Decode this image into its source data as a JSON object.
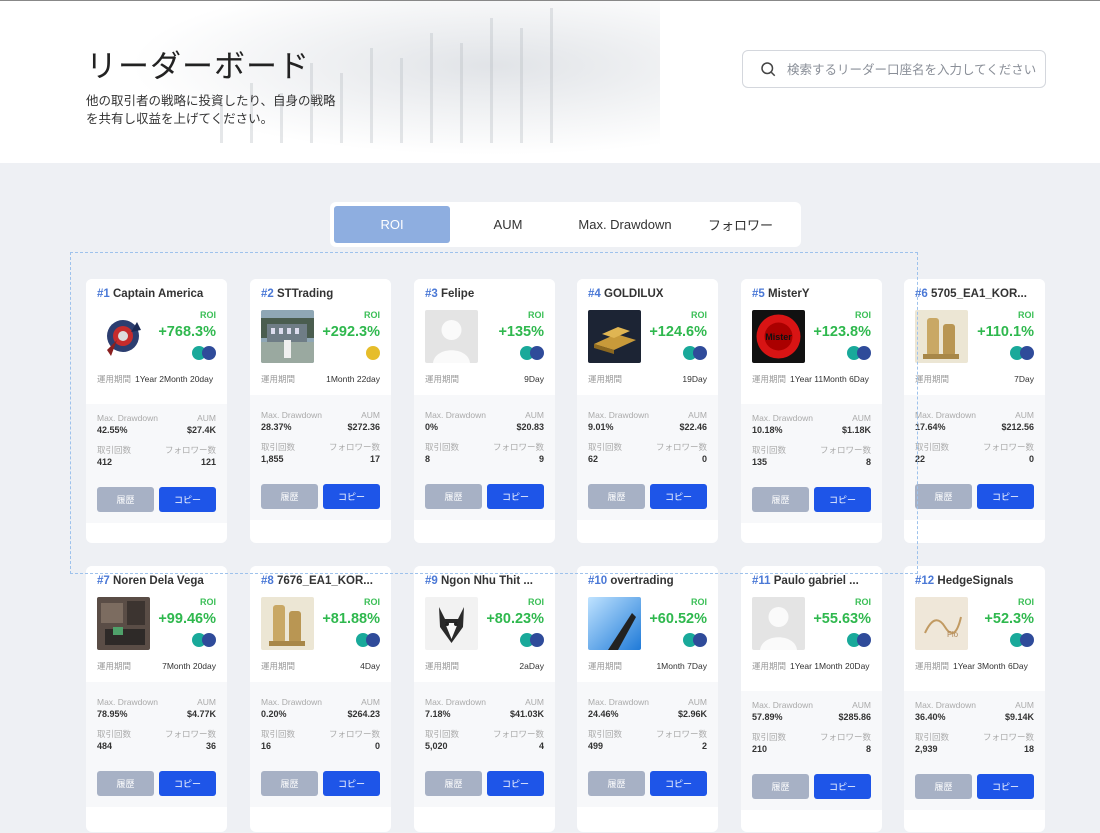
{
  "header": {
    "title": "リーダーボード",
    "subtitle": "他の取引者の戦略に投資したり、自身の戦略を共有し収益を上げてください。"
  },
  "search": {
    "placeholder": "検索するリーダー口座名を入力してください"
  },
  "tabs": [
    {
      "label": "ROI",
      "active": true
    },
    {
      "label": "AUM",
      "active": false
    },
    {
      "label": "Max. Drawdown",
      "active": false
    },
    {
      "label": "フォロワー",
      "active": false
    }
  ],
  "labels": {
    "roi": "ROI",
    "period": "運用期間",
    "max_drawdown": "Max. Drawdown",
    "aum": "AUM",
    "trades": "取引回数",
    "followers": "フォロワー数",
    "history": "履歴",
    "copy": "コピー"
  },
  "colors": {
    "accent": "#1e55e8",
    "tab_active": "#8eaee0",
    "roi_green": "#2fb84e",
    "rank_blue": "#4a78d6"
  },
  "cards": [
    {
      "rank": "#1",
      "name": "Captain America",
      "roi": "+768.3%",
      "period": "1Year 2Month 20day",
      "max_drawdown": "42.55%",
      "aum": "$27.4K",
      "trades": "412",
      "followers": "121",
      "avatar": "captain-america-art"
    },
    {
      "rank": "#2",
      "name": "STTrading",
      "roi": "+292.3%",
      "period": "1Month 22day",
      "max_drawdown": "28.37%",
      "aum": "$272.36",
      "trades": "1,855",
      "followers": "17",
      "avatar": "building-photo"
    },
    {
      "rank": "#3",
      "name": "Felipe",
      "roi": "+135%",
      "period": "9Day",
      "max_drawdown": "0%",
      "aum": "$20.83",
      "trades": "8",
      "followers": "9",
      "avatar": "default-user"
    },
    {
      "rank": "#4",
      "name": "GOLDILUX",
      "roi": "+124.6%",
      "period": "19Day",
      "max_drawdown": "9.01%",
      "aum": "$22.46",
      "trades": "62",
      "followers": "0",
      "avatar": "gold-bars"
    },
    {
      "rank": "#5",
      "name": "MisterY",
      "roi": "+123.8%",
      "period": "1Year 11Month 6Day",
      "max_drawdown": "10.18%",
      "aum": "$1.18K",
      "trades": "135",
      "followers": "8",
      "avatar": "red-logo"
    },
    {
      "rank": "#6",
      "name": "5705_EA1_KOR...",
      "roi": "+110.1%",
      "period": "7Day",
      "max_drawdown": "17.64%",
      "aum": "$212.56",
      "trades": "22",
      "followers": "0",
      "avatar": "gold-figure"
    },
    {
      "rank": "#7",
      "name": "Noren Dela Vega",
      "roi": "+99.46%",
      "period": "7Month 20day",
      "max_drawdown": "78.95%",
      "aum": "$4.77K",
      "trades": "484",
      "followers": "36",
      "avatar": "room-photo"
    },
    {
      "rank": "#8",
      "name": "7676_EA1_KOR...",
      "roi": "+81.88%",
      "period": "4Day",
      "max_drawdown": "0.20%",
      "aum": "$264.23",
      "trades": "16",
      "followers": "0",
      "avatar": "gold-figure"
    },
    {
      "rank": "#9",
      "name": "Ngon Nhu Thit ...",
      "roi": "+80.23%",
      "period": "2aDay",
      "max_drawdown": "7.18%",
      "aum": "$41.03K",
      "trades": "5,020",
      "followers": "4",
      "avatar": "husky-photo"
    },
    {
      "rank": "#10",
      "name": "overtrading",
      "roi": "+60.52%",
      "period": "1Month 7Day",
      "max_drawdown": "24.46%",
      "aum": "$2.96K",
      "trades": "499",
      "followers": "2",
      "avatar": "blue-sky"
    },
    {
      "rank": "#11",
      "name": "Paulo gabriel ...",
      "roi": "+55.63%",
      "period": "1Year 1Month 20Day",
      "max_drawdown": "57.89%",
      "aum": "$285.86",
      "trades": "210",
      "followers": "8",
      "avatar": "default-user"
    },
    {
      "rank": "#12",
      "name": "HedgeSignals",
      "roi": "+52.3%",
      "period": "1Year 3Month 6Day",
      "max_drawdown": "36.40%",
      "aum": "$9.14K",
      "trades": "2,939",
      "followers": "18",
      "avatar": "sketch-logo"
    }
  ]
}
